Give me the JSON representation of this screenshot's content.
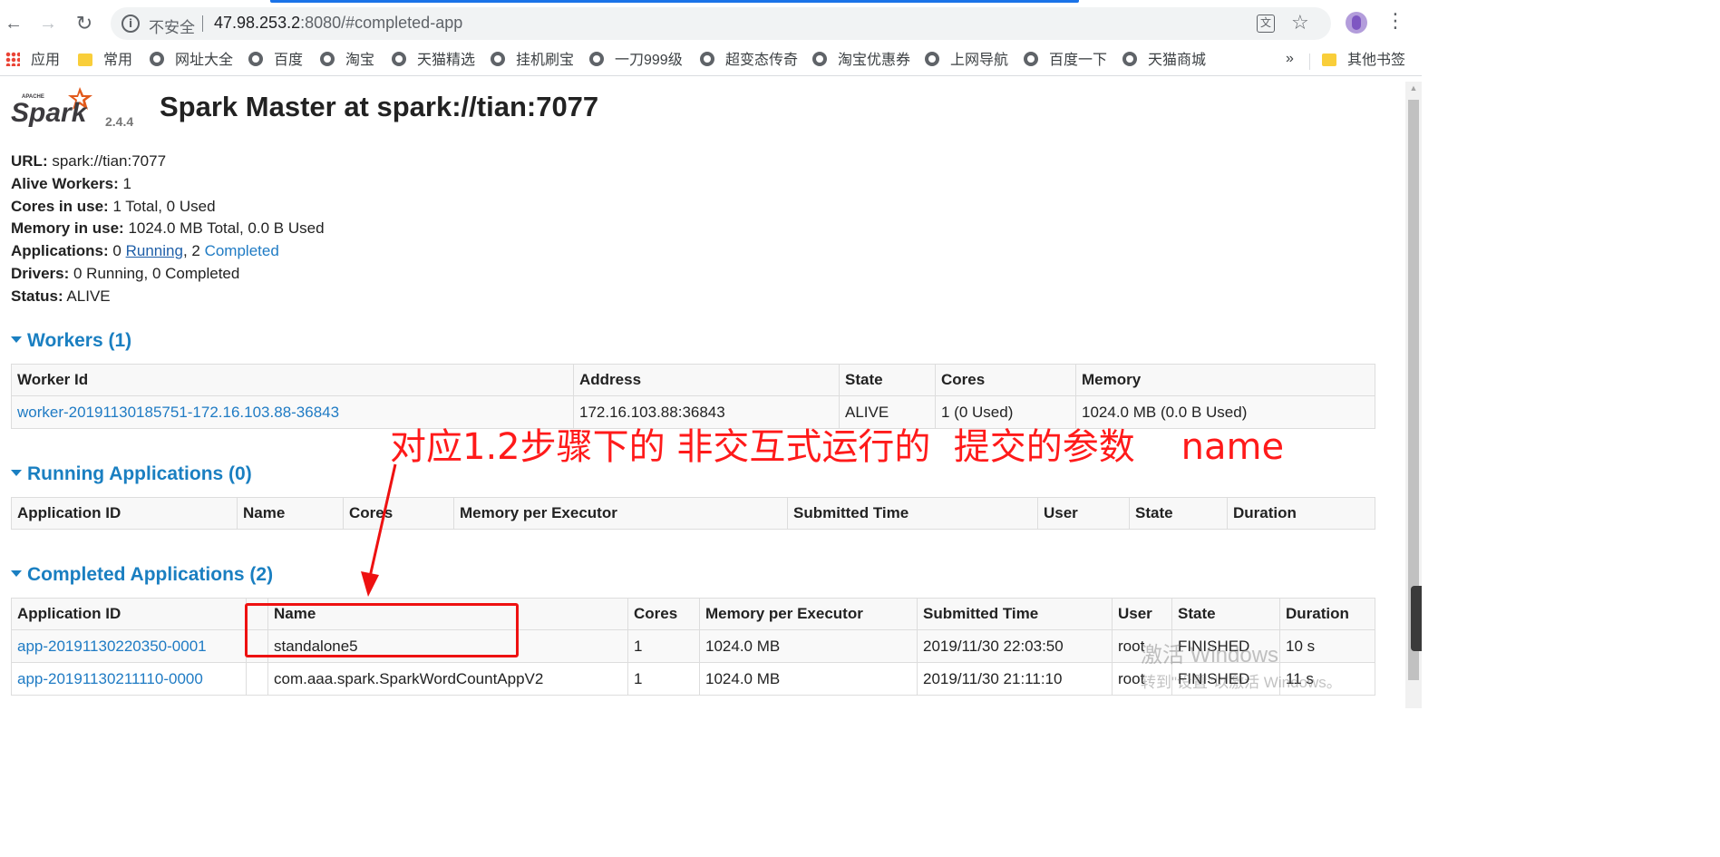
{
  "browser": {
    "nav": {
      "back": "←",
      "forward": "→",
      "reload": "↻"
    },
    "omnibox": {
      "insecure_label": "不安全",
      "url_host": "47.98.253.2",
      "url_rest": ":8080/#completed-app"
    },
    "icons": [
      "info-icon",
      "translate-icon",
      "star-icon",
      "profile-avatar",
      "menu-icon"
    ]
  },
  "bookmarks": [
    {
      "label": "应用",
      "icon": "apps-icon"
    },
    {
      "label": "常用",
      "icon": "folder-icon"
    },
    {
      "label": "网址大全",
      "icon": "globe-icon"
    },
    {
      "label": "百度",
      "icon": "globe-icon"
    },
    {
      "label": "淘宝",
      "icon": "globe-icon"
    },
    {
      "label": "天猫精选",
      "icon": "globe-icon"
    },
    {
      "label": "挂机刷宝",
      "icon": "globe-icon"
    },
    {
      "label": "一刀999级",
      "icon": "globe-icon"
    },
    {
      "label": "超变态传奇",
      "icon": "globe-icon"
    },
    {
      "label": "淘宝优惠券",
      "icon": "globe-icon"
    },
    {
      "label": "上网导航",
      "icon": "globe-icon"
    },
    {
      "label": "百度一下",
      "icon": "globe-icon"
    },
    {
      "label": "天猫商城",
      "icon": "globe-icon"
    }
  ],
  "bookmarks_more": "»",
  "bookmarks_other": "其他书签",
  "spark": {
    "logo_text": "Spark",
    "logo_apache": "APACHE",
    "version": "2.4.4",
    "title": "Spark Master at spark://tian:7077",
    "info": {
      "url_label": "URL:",
      "url_value": "spark://tian:7077",
      "alive_workers_label": "Alive Workers:",
      "alive_workers_value": "1",
      "cores_label": "Cores in use:",
      "cores_value": "1 Total, 0 Used",
      "memory_label": "Memory in use:",
      "memory_value": "1024.0 MB Total, 0.0 B Used",
      "apps_label": "Applications:",
      "apps_running_count": "0",
      "apps_running_link": "Running",
      "apps_completed_count": ", 2",
      "apps_completed_link": "Completed",
      "drivers_label": "Drivers:",
      "drivers_value": "0 Running, 0 Completed",
      "status_label": "Status:",
      "status_value": "ALIVE"
    }
  },
  "workers": {
    "title": "Workers (1)",
    "headers": [
      "Worker Id",
      "Address",
      "State",
      "Cores",
      "Memory"
    ],
    "rows": [
      [
        "worker-20191130185751-172.16.103.88-36843",
        "172.16.103.88:36843",
        "ALIVE",
        "1 (0 Used)",
        "1024.0 MB (0.0 B Used)"
      ]
    ]
  },
  "running_apps": {
    "title": "Running Applications (0)",
    "headers": [
      "Application ID",
      "Name",
      "Cores",
      "Memory per Executor",
      "Submitted Time",
      "User",
      "State",
      "Duration"
    ]
  },
  "completed_apps": {
    "title": "Completed Applications (2)",
    "headers": [
      "Application ID",
      "",
      "Name",
      "Cores",
      "Memory per Executor",
      "Submitted Time",
      "User",
      "State",
      "Duration"
    ],
    "rows": [
      [
        "app-20191130220350-0001",
        "",
        "standalone5",
        "1",
        "1024.0 MB",
        "2019/11/30 22:03:50",
        "root",
        "FINISHED",
        "10 s"
      ],
      [
        "app-20191130211110-0000",
        "",
        "com.aaa.spark.SparkWordCountAppV2",
        "1",
        "1024.0 MB",
        "2019/11/30 21:11:10",
        "root",
        "FINISHED",
        "11 s"
      ]
    ]
  },
  "annotation": {
    "text": "对应1.2步骤下的 非交互式运行的  提交的参数    name",
    "color": "#ff1a1a"
  },
  "watermark": {
    "line1": "激活 Windows",
    "line2": "转到\"设置\"以激活 Windows。"
  }
}
